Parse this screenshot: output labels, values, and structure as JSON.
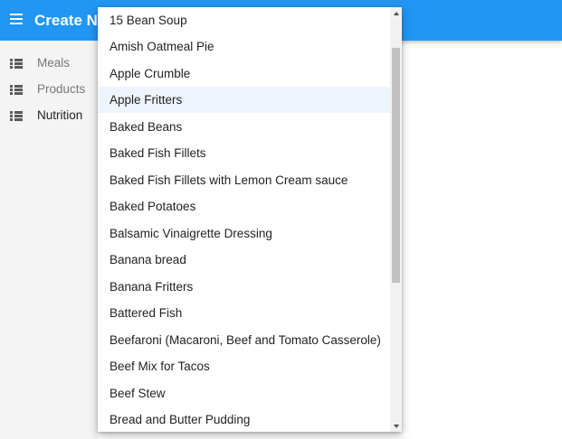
{
  "app": {
    "title": "Create Nutrition",
    "accent_color": "#2196f3"
  },
  "menu_icon": "hamburger-menu-icon",
  "sidebar": {
    "items": [
      {
        "label": "Meals",
        "icon": "list-icon",
        "active": false
      },
      {
        "label": "Products",
        "icon": "list-icon",
        "active": false
      },
      {
        "label": "Nutrition",
        "icon": "list-icon",
        "active": true
      }
    ]
  },
  "dropdown": {
    "highlighted_option": "Apple Fritters",
    "options": [
      "15 Bean Soup",
      "Amish Oatmeal Pie",
      "Apple Crumble",
      "Apple Fritters",
      "Baked Beans",
      "Baked Fish Fillets",
      "Baked Fish Fillets with Lemon Cream sauce",
      "Baked Potatoes",
      "Balsamic Vinaigrette Dressing",
      "Banana bread",
      "Banana Fritters",
      "Battered Fish",
      "Beefaroni (Macaroni, Beef and Tomato Casserole)",
      "Beef Mix for Tacos",
      "Beef Stew",
      "Bread and Butter Pudding"
    ]
  }
}
